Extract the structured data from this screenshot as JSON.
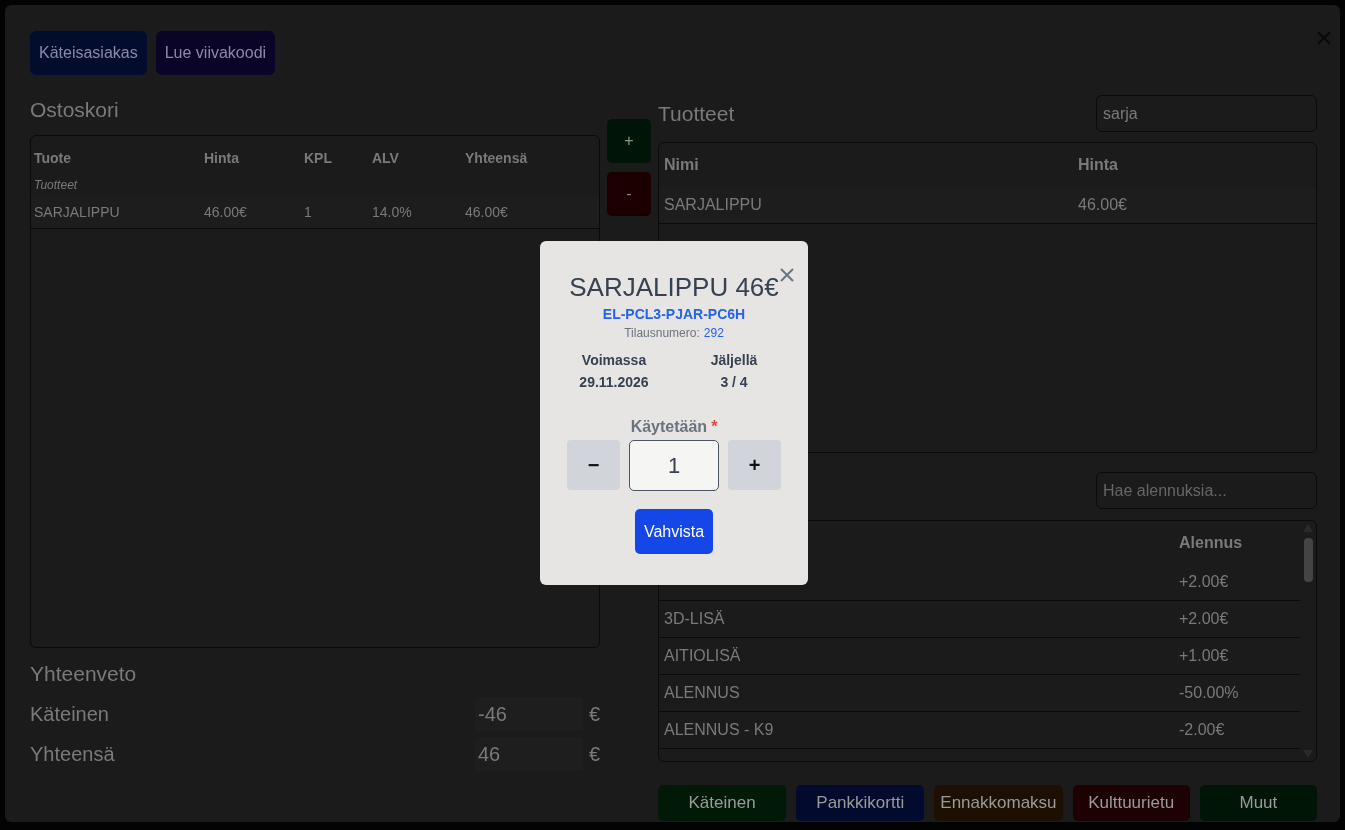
{
  "top_buttons": [
    {
      "label": "Käteisasiakas",
      "color": "#020c2c"
    },
    {
      "label": "Lue viivakoodi",
      "color": "#0a0426"
    }
  ],
  "cart": {
    "title": "Ostoskori",
    "columns": [
      "Tuote",
      "Hinta",
      "KPL",
      "ALV",
      "Yhteensä"
    ],
    "group_label": "Tuotteet",
    "rows": [
      {
        "cells": [
          "SARJALIPPU",
          "46.00€",
          "1",
          "14.0%",
          "46.00€"
        ]
      }
    ]
  },
  "cart_actions": [
    {
      "label": "+",
      "color": "#001507"
    },
    {
      "label": "-",
      "color": "#1c0000"
    }
  ],
  "summary": {
    "title": "Yhteenveto",
    "rows": [
      {
        "label": "Käteinen",
        "value": "-46",
        "unit": "€"
      },
      {
        "label": "Yhteensä",
        "value": "46",
        "unit": "€"
      }
    ]
  },
  "products": {
    "title": "Tuotteet",
    "search": {
      "value": "sarja"
    },
    "columns": [
      "Nimi",
      "Hinta"
    ],
    "rows": [
      {
        "name": "SARJALIPPU",
        "price": "46.00€"
      }
    ]
  },
  "discounts": {
    "search": {
      "placeholder": "Hae alennuksia..."
    },
    "column": "Alennus",
    "rows": [
      {
        "discount": "+2.00€"
      },
      {
        "name": "3D-LISÄ",
        "discount": "+2.00€"
      },
      {
        "name": "AITIOLISÄ",
        "discount": "+1.00€"
      },
      {
        "name": "ALENNUS",
        "discount": "-50.00%"
      },
      {
        "name": "ALENNUS - K9",
        "discount": "-2.00€"
      }
    ]
  },
  "payment_buttons": [
    {
      "label": "Käteinen",
      "color": "#001a07"
    },
    {
      "label": "Pankkikortti",
      "color": "#020b2e"
    },
    {
      "label": "Ennakkomaksu",
      "color": "#1d1002"
    },
    {
      "label": "Kulttuurietu",
      "color": "#1e0103"
    },
    {
      "label": "Muut",
      "color": "#001506"
    }
  ],
  "dialog": {
    "title": "SARJALIPPU 46€",
    "code": "EL-PCL3-PJAR-PC6H",
    "order_label": "Tilausnumero:",
    "order_number": "292",
    "stats": [
      {
        "label": "Voimassa",
        "value": "29.11.2026"
      },
      {
        "label": "Jäljellä",
        "value": "3 / 4"
      }
    ],
    "quantity": {
      "label": "Käytetään",
      "required": true,
      "required_mark": "*",
      "minus": "−",
      "value": "1",
      "plus": "+"
    },
    "confirm": "Vahvista"
  }
}
